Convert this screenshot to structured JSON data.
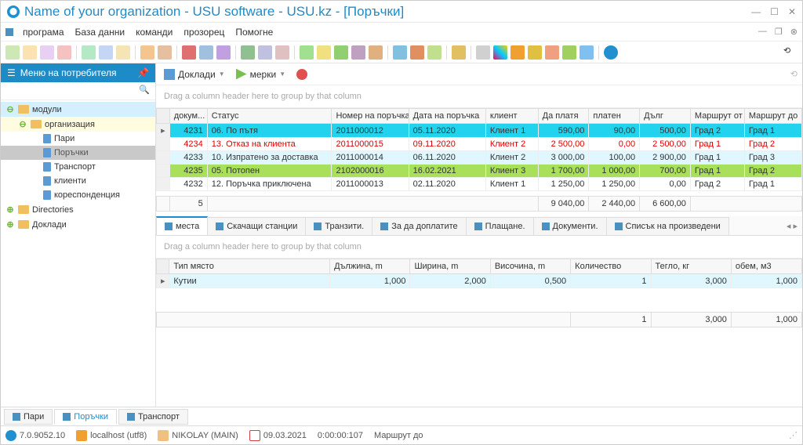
{
  "window": {
    "title": "Name of your organization - USU software - USU.kz - [Поръчки]"
  },
  "menu": {
    "items": [
      "програма",
      "База данни",
      "команди",
      "прозорец",
      "Помогне"
    ]
  },
  "sidebar": {
    "title": "Меню на потребителя",
    "tree": {
      "modules": "модули",
      "organization": "организация",
      "pari": "Пари",
      "orders": "Поръчки",
      "transport": "Транспорт",
      "clients": "клиенти",
      "correspondence": "кореспонденция",
      "directories": "Directories",
      "reports": "Доклади"
    }
  },
  "content_toolbar": {
    "reports": "Доклади",
    "measures": "мерки"
  },
  "group_hint": "Drag a column header here to group by that column",
  "grid": {
    "headers": {
      "doc": "докум...",
      "status": "Статус",
      "order_no": "Номер на поръчка",
      "order_date": "Дата на поръчка",
      "client": "клиент",
      "to_pay": "Да платя",
      "paid": "платен",
      "debt": "Дълг",
      "route_from": "Маршрут от",
      "route_to": "Маршрут до"
    },
    "rows": [
      {
        "doc": "4231",
        "status": "06. По пътя",
        "order_no": "2011000012",
        "order_date": "05.11.2020",
        "client": "Клиент 1",
        "to_pay": "590,00",
        "paid": "90,00",
        "debt": "500,00",
        "from": "Град 2",
        "to": "Град 1"
      },
      {
        "doc": "4234",
        "status": "13. Отказ на клиента",
        "order_no": "2011000015",
        "order_date": "09.11.2020",
        "client": "Клиент 2",
        "to_pay": "2 500,00",
        "paid": "0,00",
        "debt": "2 500,00",
        "from": "Град 1",
        "to": "Град 2"
      },
      {
        "doc": "4233",
        "status": "10. Изпратено за доставка",
        "order_no": "2011000014",
        "order_date": "06.11.2020",
        "client": "Клиент 2",
        "to_pay": "3 000,00",
        "paid": "100,00",
        "debt": "2 900,00",
        "from": "Град 1",
        "to": "Град 3"
      },
      {
        "doc": "4235",
        "status": "05. Потопен",
        "order_no": "2102000016",
        "order_date": "16.02.2021",
        "client": "Клиент 3",
        "to_pay": "1 700,00",
        "paid": "1 000,00",
        "debt": "700,00",
        "from": "Град 1",
        "to": "Град 2"
      },
      {
        "doc": "4232",
        "status": "12. Поръчка приключена",
        "order_no": "2011000013",
        "order_date": "02.11.2020",
        "client": "Клиент 1",
        "to_pay": "1 250,00",
        "paid": "1 250,00",
        "debt": "0,00",
        "from": "Град 2",
        "to": "Град 1"
      }
    ],
    "summary": {
      "count": "5",
      "to_pay": "9 040,00",
      "paid": "2 440,00",
      "debt": "6 600,00"
    }
  },
  "sub_tabs": {
    "items": [
      "места",
      "Скачащи станции",
      "Транзити.",
      "За да доплатите",
      "Плащане.",
      "Документи.",
      "Списък на произведени"
    ]
  },
  "detail": {
    "headers": {
      "type": "Тип място",
      "length": "Дължина, m",
      "width": "Ширина, m",
      "height": "Височина, m",
      "qty": "Количество",
      "weight": "Тегло, кг",
      "volume": "обем, м3"
    },
    "row": {
      "type": "Кутии",
      "length": "1,000",
      "width": "2,000",
      "height": "0,500",
      "qty": "1",
      "weight": "3,000",
      "volume": "1,000"
    },
    "summary": {
      "qty": "1",
      "weight": "3,000",
      "volume": "1,000"
    }
  },
  "bottom_tabs": {
    "items": [
      "Пари",
      "Поръчки",
      "Транспорт"
    ]
  },
  "status": {
    "version": "7.0.9052.10",
    "host": "localhost (utf8)",
    "user": "NIKOLAY (MAIN)",
    "date": "09.03.2021",
    "time": "0:00:00:107",
    "route": "Маршрут до"
  }
}
